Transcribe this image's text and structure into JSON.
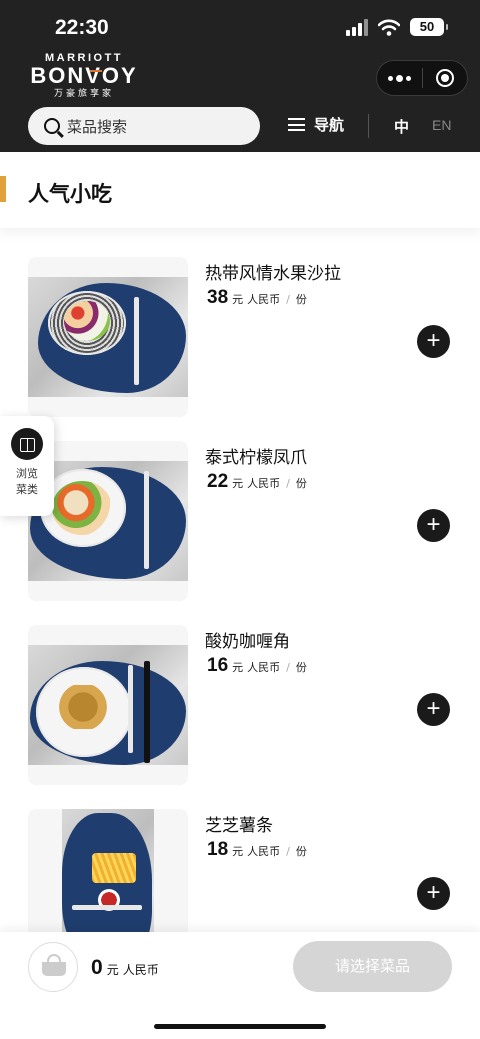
{
  "status_bar": {
    "time": "22:30",
    "battery": "50"
  },
  "brand": {
    "top": "MARRIOTT",
    "main": "BONVOY",
    "sub": "万豪旅享家"
  },
  "header": {
    "search_placeholder": "菜品搜索",
    "nav_label": "导航",
    "lang_zh": "中",
    "lang_en": "EN"
  },
  "section": {
    "title": "人气小吃"
  },
  "browse": {
    "line1": "浏览",
    "line2": "菜类"
  },
  "menu_items": [
    {
      "name": "热带风情水果沙拉",
      "price": "38",
      "currency": "元",
      "currency_name": "人民币",
      "separator": "/",
      "unit": "份"
    },
    {
      "name": "泰式柠檬凤爪",
      "price": "22",
      "currency": "元",
      "currency_name": "人民币",
      "separator": "/",
      "unit": "份"
    },
    {
      "name": "酸奶咖喱角",
      "price": "16",
      "currency": "元",
      "currency_name": "人民币",
      "separator": "/",
      "unit": "份"
    },
    {
      "name": "芝芝薯条",
      "price": "18",
      "currency": "元",
      "currency_name": "人民币",
      "separator": "/",
      "unit": "份"
    }
  ],
  "add_symbol": "+",
  "cart": {
    "total": "0",
    "currency": "元",
    "currency_name": "人民币",
    "checkout_label": "请选择菜品"
  },
  "colors": {
    "header_bg": "#222222",
    "accent": "#e0a03a",
    "placemat": "#1f3d6e",
    "checkout_disabled": "#d5d5d5"
  }
}
